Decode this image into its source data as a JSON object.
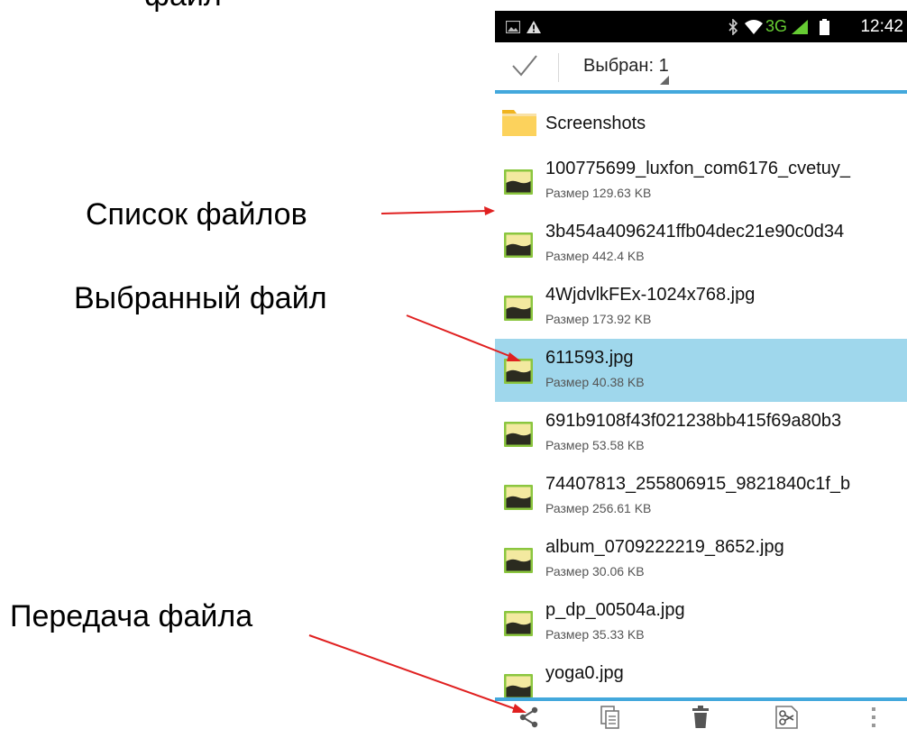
{
  "annotations": {
    "top_partial": "файл",
    "file_list": "Список файлов",
    "selected_file": "Выбранный файл",
    "file_transfer": "Передача файла"
  },
  "status_bar": {
    "time": "12:42",
    "network": "3G",
    "icons": [
      "gallery-icon",
      "warning-icon",
      "bluetooth-icon",
      "wifi-icon",
      "signal-icon",
      "battery-icon"
    ]
  },
  "action_bar": {
    "selected_label": "Выбран: 1",
    "icons": [
      "checkmark-icon",
      "dropdown-corner-icon"
    ]
  },
  "files": [
    {
      "name": "Screenshots",
      "size": "",
      "type": "folder"
    },
    {
      "name": "100775699_luxfon_com6176_cvetuy_",
      "size": "Размер 129.63 KB",
      "type": "image"
    },
    {
      "name": "3b454a4096241ffb04dec21e90c0d34",
      "size": "Размер 442.4 KB",
      "type": "image"
    },
    {
      "name": "4WjdvlkFEx-1024x768.jpg",
      "size": "Размер 173.92 KB",
      "type": "image"
    },
    {
      "name": "611593.jpg",
      "size": "Размер 40.38 KB",
      "type": "image",
      "selected": true
    },
    {
      "name": "691b9108f43f021238bb415f69a80b3",
      "size": "Размер 53.58 KB",
      "type": "image"
    },
    {
      "name": "74407813_255806915_9821840c1f_b",
      "size": "Размер 256.61 KB",
      "type": "image"
    },
    {
      "name": "album_0709222219_8652.jpg",
      "size": "Размер 30.06 KB",
      "type": "image"
    },
    {
      "name": "p_dp_00504a.jpg",
      "size": "Размер 35.33 KB",
      "type": "image"
    },
    {
      "name": "yoga0.jpg",
      "size": "",
      "type": "image"
    }
  ],
  "bottom_toolbar": [
    "share-icon",
    "copy-icon",
    "delete-icon",
    "cut-icon",
    "overflow-menu-icon"
  ],
  "colors": {
    "accent": "#43a8dc",
    "selected_row": "#9fd7ec",
    "status_green": "#66cc33",
    "arrow": "#e02020"
  }
}
